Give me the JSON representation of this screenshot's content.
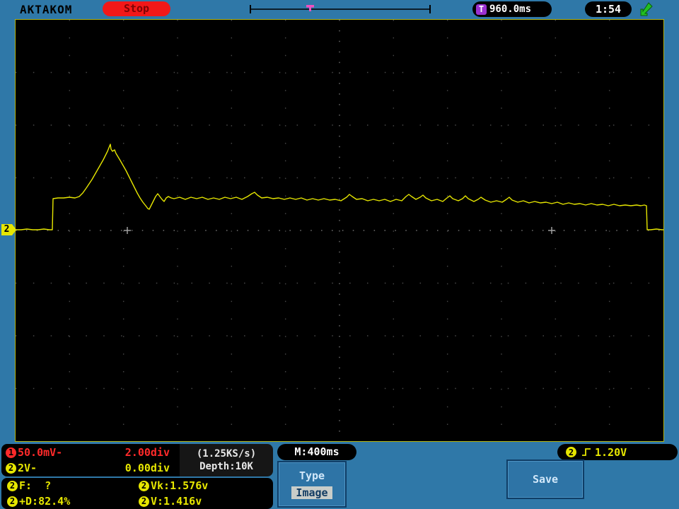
{
  "top_bar": {
    "brand": "AKTAKOM",
    "run_state": "Stop",
    "trigger_time_label": "T",
    "trigger_time": "960.0ms",
    "clock": "1:54"
  },
  "screen": {
    "channel_marker": "2"
  },
  "chart_data": {
    "type": "line",
    "title": "",
    "xlabel": "time (400ms/div)",
    "ylabel": "CH2 voltage (2V/div)",
    "divisions": {
      "x": 12,
      "y": 8
    },
    "center_markers": [
      [
        158,
        298
      ],
      [
        758,
        298
      ]
    ],
    "series": [
      {
        "name": "CH2",
        "color": "#e6e600",
        "units": "screen_px",
        "points": [
          [
            0,
            297
          ],
          [
            8,
            297
          ],
          [
            16,
            296
          ],
          [
            24,
            297
          ],
          [
            32,
            297
          ],
          [
            40,
            296
          ],
          [
            48,
            297
          ],
          [
            52,
            297
          ],
          [
            53,
            253
          ],
          [
            60,
            252
          ],
          [
            68,
            252
          ],
          [
            76,
            251
          ],
          [
            84,
            252
          ],
          [
            90,
            250
          ],
          [
            95,
            245
          ],
          [
            100,
            238
          ],
          [
            104,
            232
          ],
          [
            108,
            226
          ],
          [
            112,
            219
          ],
          [
            116,
            212
          ],
          [
            120,
            205
          ],
          [
            124,
            198
          ],
          [
            127,
            192
          ],
          [
            130,
            186
          ],
          [
            132,
            181
          ],
          [
            134,
            176
          ],
          [
            135,
            183
          ],
          [
            137,
            186
          ],
          [
            140,
            184
          ],
          [
            142,
            189
          ],
          [
            145,
            194
          ],
          [
            148,
            199
          ],
          [
            152,
            206
          ],
          [
            156,
            213
          ],
          [
            160,
            221
          ],
          [
            164,
            229
          ],
          [
            168,
            237
          ],
          [
            172,
            245
          ],
          [
            176,
            252
          ],
          [
            180,
            258
          ],
          [
            184,
            263
          ],
          [
            187,
            267
          ],
          [
            189,
            268
          ],
          [
            192,
            262
          ],
          [
            195,
            256
          ],
          [
            198,
            250
          ],
          [
            201,
            246
          ],
          [
            204,
            250
          ],
          [
            207,
            254
          ],
          [
            210,
            257
          ],
          [
            213,
            252
          ],
          [
            216,
            250
          ],
          [
            220,
            252
          ],
          [
            224,
            253
          ],
          [
            232,
            251
          ],
          [
            240,
            254
          ],
          [
            248,
            251
          ],
          [
            256,
            253
          ],
          [
            264,
            251
          ],
          [
            272,
            254
          ],
          [
            280,
            252
          ],
          [
            288,
            254
          ],
          [
            296,
            251
          ],
          [
            304,
            253
          ],
          [
            312,
            251
          ],
          [
            320,
            254
          ],
          [
            328,
            250
          ],
          [
            334,
            246
          ],
          [
            338,
            244
          ],
          [
            342,
            248
          ],
          [
            348,
            252
          ],
          [
            356,
            251
          ],
          [
            364,
            253
          ],
          [
            372,
            252
          ],
          [
            380,
            254
          ],
          [
            388,
            252
          ],
          [
            396,
            254
          ],
          [
            404,
            252
          ],
          [
            412,
            255
          ],
          [
            420,
            253
          ],
          [
            428,
            255
          ],
          [
            436,
            253
          ],
          [
            444,
            255
          ],
          [
            452,
            254
          ],
          [
            460,
            256
          ],
          [
            468,
            251
          ],
          [
            472,
            247
          ],
          [
            476,
            250
          ],
          [
            482,
            254
          ],
          [
            490,
            253
          ],
          [
            498,
            256
          ],
          [
            506,
            254
          ],
          [
            514,
            256
          ],
          [
            522,
            254
          ],
          [
            530,
            257
          ],
          [
            538,
            254
          ],
          [
            546,
            256
          ],
          [
            552,
            250
          ],
          [
            556,
            247
          ],
          [
            560,
            250
          ],
          [
            566,
            254
          ],
          [
            572,
            251
          ],
          [
            576,
            248
          ],
          [
            580,
            252
          ],
          [
            588,
            256
          ],
          [
            596,
            254
          ],
          [
            604,
            257
          ],
          [
            610,
            252
          ],
          [
            614,
            249
          ],
          [
            618,
            253
          ],
          [
            626,
            256
          ],
          [
            632,
            253
          ],
          [
            636,
            249
          ],
          [
            640,
            253
          ],
          [
            648,
            257
          ],
          [
            654,
            254
          ],
          [
            658,
            251
          ],
          [
            664,
            255
          ],
          [
            672,
            258
          ],
          [
            680,
            256
          ],
          [
            688,
            258
          ],
          [
            694,
            254
          ],
          [
            698,
            251
          ],
          [
            702,
            255
          ],
          [
            710,
            258
          ],
          [
            718,
            256
          ],
          [
            726,
            259
          ],
          [
            734,
            257
          ],
          [
            742,
            259
          ],
          [
            750,
            258
          ],
          [
            758,
            260
          ],
          [
            766,
            258
          ],
          [
            774,
            261
          ],
          [
            782,
            259
          ],
          [
            790,
            261
          ],
          [
            798,
            260
          ],
          [
            806,
            262
          ],
          [
            814,
            260
          ],
          [
            822,
            262
          ],
          [
            830,
            261
          ],
          [
            838,
            263
          ],
          [
            846,
            261
          ],
          [
            854,
            263
          ],
          [
            862,
            262
          ],
          [
            870,
            263
          ],
          [
            878,
            262
          ],
          [
            884,
            263
          ],
          [
            889,
            262
          ],
          [
            892,
            263
          ],
          [
            893,
            297
          ],
          [
            898,
            297
          ],
          [
            906,
            296
          ],
          [
            914,
            297
          ],
          [
            916,
            297
          ]
        ]
      }
    ]
  },
  "bottom": {
    "ch1": {
      "num": "1",
      "scale": "50.0mV-",
      "offset": "2.00div"
    },
    "ch2": {
      "num": "2",
      "scale": "2V-",
      "offset": "0.00div"
    },
    "sample_rate": "(1.25KS/s)",
    "depth": "Depth:10K",
    "timebase": "M:400ms",
    "trigger": {
      "num": "2",
      "level": "1.20V"
    },
    "measurements": [
      {
        "num": "2",
        "text": "F:  ?"
      },
      {
        "num": "2",
        "text": "Vk:1.576v"
      },
      {
        "num": "2",
        "text": "+D:82.4%"
      },
      {
        "num": "2",
        "text": "V:1.416v"
      }
    ],
    "type_button": {
      "label": "Type",
      "value": "Image"
    },
    "save_label": "Save"
  },
  "colors": {
    "background": "#2f78a8",
    "trace": "#e6e600",
    "ch1": "#ff2a2a",
    "ch2": "#e6e600",
    "stop_red": "#f21818",
    "trigger_icon_purple": "#9a30d0",
    "trigger_marker_pink": "#f050c0",
    "usb_green": "#22c022"
  }
}
